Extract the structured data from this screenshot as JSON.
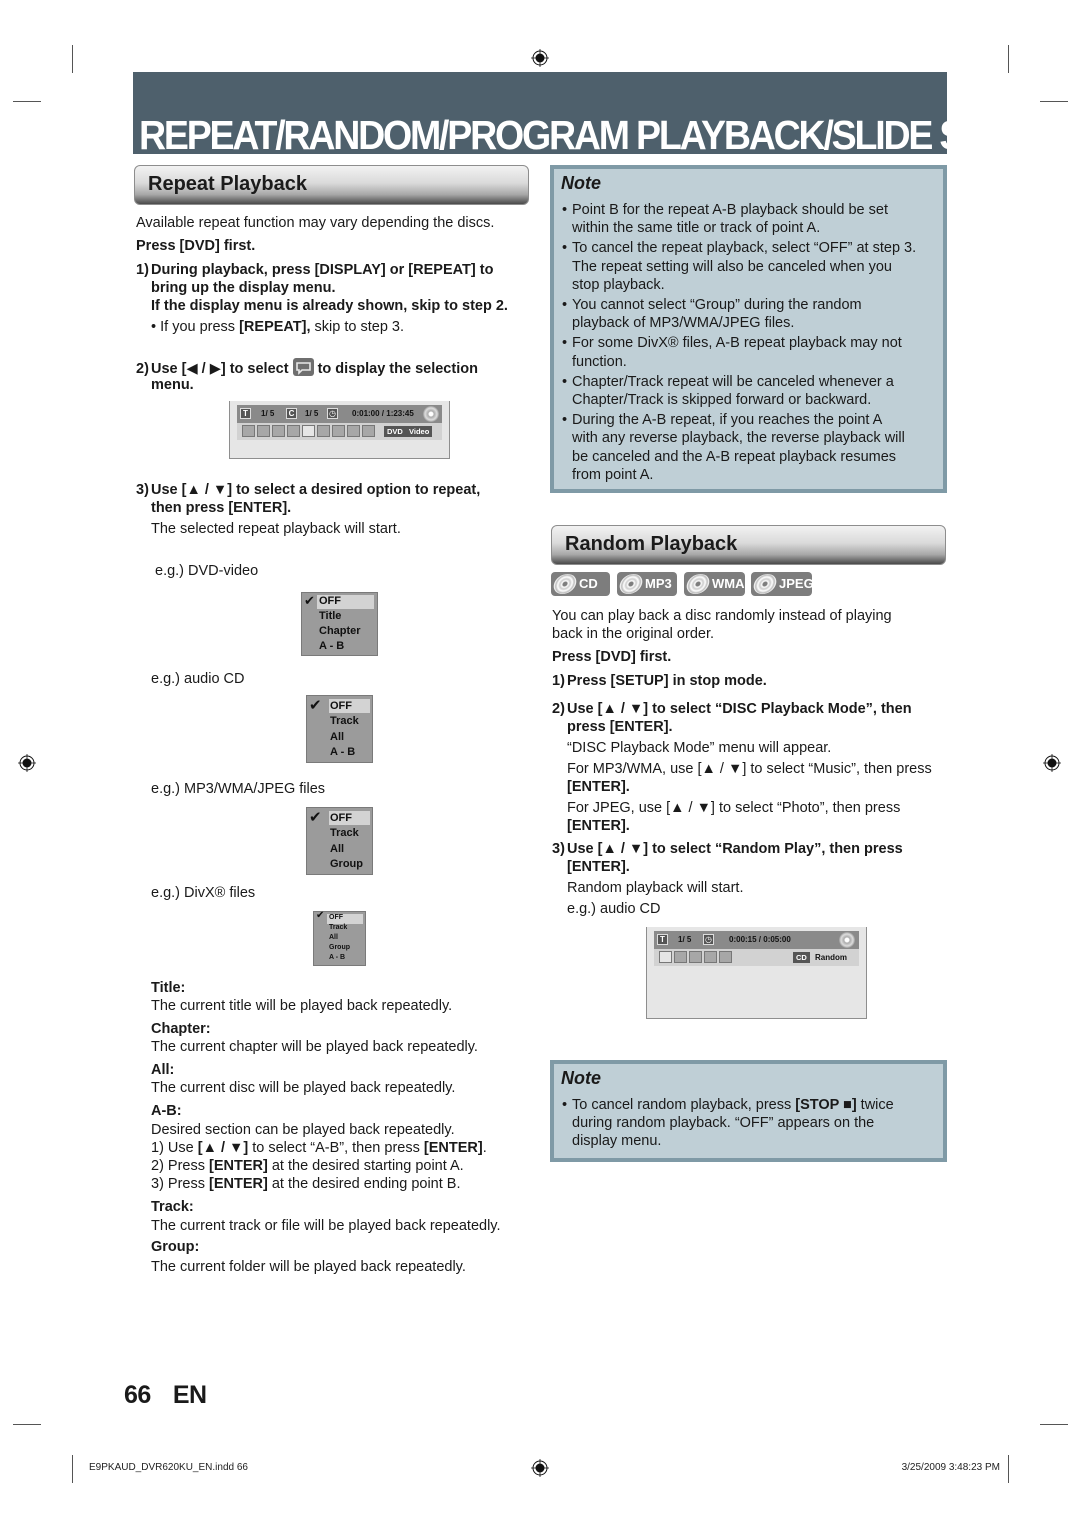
{
  "banner": {
    "title": "REPEAT/RANDOM/PROGRAM PLAYBACK/SLIDE SHOW"
  },
  "repeat": {
    "heading": "Repeat Playback",
    "intro": "Available repeat function may vary depending the discs.",
    "press_dvd": "Press [DVD] first.",
    "step1": {
      "num": "1)",
      "line1": "During playback, press [DISPLAY] or [REPEAT] to",
      "line2": "bring up the display menu.",
      "line3": "If the display menu is already shown, skip to step 2.",
      "bullet_pre": "• If you press ",
      "bullet_bold": "[REPEAT],",
      "bullet_post": " skip to step 3."
    },
    "step2": {
      "num": "2)",
      "pre": "Use [◀ / ▶] to select ",
      "icon": "repeat-icon",
      "post": " to display the selection",
      "line2": "menu."
    },
    "osd": {
      "title_label": "T",
      "title_pos": "1/  5",
      "chapter_label": "C",
      "chapter_pos": "1/  5",
      "time": "0:01:00 / 1:23:45",
      "tag1": "DVD",
      "tag2": "Video"
    },
    "step3": {
      "num": "3)",
      "line1": "Use [▲ / ▼] to select a desired option to repeat,",
      "line2": "then press [ENTER].",
      "desc": "The selected repeat playback will start."
    },
    "examples": [
      {
        "label": "e.g.) DVD-video",
        "options": [
          "OFF",
          "Title",
          "Chapter",
          "A - B"
        ]
      },
      {
        "label": "e.g.) audio CD",
        "options": [
          "OFF",
          "Track",
          "All",
          "A - B"
        ]
      },
      {
        "label": "e.g.) MP3/WMA/JPEG files",
        "options": [
          "OFF",
          "Track",
          "All",
          "Group"
        ]
      },
      {
        "label": "e.g.) DivX® files",
        "options": [
          "OFF",
          "Track",
          "All",
          "Group",
          "A - B"
        ]
      }
    ],
    "definitions": {
      "title": {
        "term": "Title:",
        "desc": "The current title will be played back repeatedly."
      },
      "chapter": {
        "term": "Chapter:",
        "desc": "The current chapter will be played back repeatedly."
      },
      "all": {
        "term": "All:",
        "desc": "The current disc will be played back repeatedly."
      },
      "ab": {
        "term": "A-B:",
        "desc": "Desired section can be played back repeatedly.",
        "s1_pre": "1) Use ",
        "s1_b1": "[▲ / ▼]",
        "s1_mid": " to select “A-B”, then press ",
        "s1_b2": "[ENTER]",
        "s1_post": ".",
        "s2_pre": "2) Press ",
        "s2_b": "[ENTER]",
        "s2_post": " at the desired starting point A.",
        "s3_pre": "3) Press ",
        "s3_b": "[ENTER]",
        "s3_post": " at the desired ending point B."
      },
      "track": {
        "term": "Track:",
        "desc": "The current track or file will be played back repeatedly."
      },
      "group": {
        "term": "Group:",
        "desc": "The current folder will be played back repeatedly."
      }
    }
  },
  "note1": {
    "title": "Note",
    "items": [
      [
        "Point B for the repeat A-B playback should be set",
        "within the same title or track of point A."
      ],
      [
        "To cancel the repeat playback, select “OFF” at step 3.",
        "The repeat setting will also be canceled when you",
        "stop playback."
      ],
      [
        "You cannot select “Group” during the random",
        "playback of MP3/WMA/JPEG files."
      ],
      [
        "For some DivX® files, A-B repeat playback may not",
        "function."
      ],
      [
        "Chapter/Track repeat will be canceled whenever a",
        "Chapter/Track is skipped forward or backward."
      ],
      [
        "During the A-B repeat, if you reaches the point A",
        "with any reverse playback, the reverse playback will",
        "be canceled and the A-B repeat playback resumes",
        "from point A."
      ]
    ]
  },
  "random": {
    "heading": "Random Playback",
    "badges": [
      "CD",
      "MP3",
      "WMA",
      "JPEG"
    ],
    "intro1": "You can play back a disc randomly instead of playing",
    "intro2": "back in the original order.",
    "press_dvd": "Press [DVD] first.",
    "step1": {
      "num": "1)",
      "text": "Press [SETUP] in stop mode."
    },
    "step2": {
      "num": "2)",
      "line1": "Use [▲ / ▼] to select “DISC Playback Mode”, then",
      "line2": "press [ENTER].",
      "desc1": "“DISC Playback Mode” menu will appear.",
      "desc2": "For MP3/WMA, use [▲ / ▼] to select “Music”, then press",
      "desc2b": "[ENTER].",
      "desc3": "For JPEG, use [▲ / ▼] to select “Photo”, then press",
      "desc3b": "[ENTER]."
    },
    "step3": {
      "num": "3)",
      "line1": "Use [▲ / ▼] to select “Random Play”, then press",
      "line2": "[ENTER].",
      "desc": "Random playback will start.",
      "example": "e.g.) audio CD"
    },
    "osd": {
      "title_label": "T",
      "title_pos": "1/  5",
      "time": "0:00:15 / 0:05:00",
      "tag": "CD",
      "mode": "Random"
    }
  },
  "note2": {
    "title": "Note",
    "pre": "To cancel random playback, press ",
    "bold": "[STOP ■]",
    "post": " twice",
    "line2": "during random playback. “OFF” appears on the",
    "line3": "display menu."
  },
  "page": {
    "number": "66",
    "lang": "EN"
  },
  "footer": {
    "left": "E9PKAUD_DVR620KU_EN.indd   66",
    "right": "3/25/2009   3:48:23 PM"
  }
}
